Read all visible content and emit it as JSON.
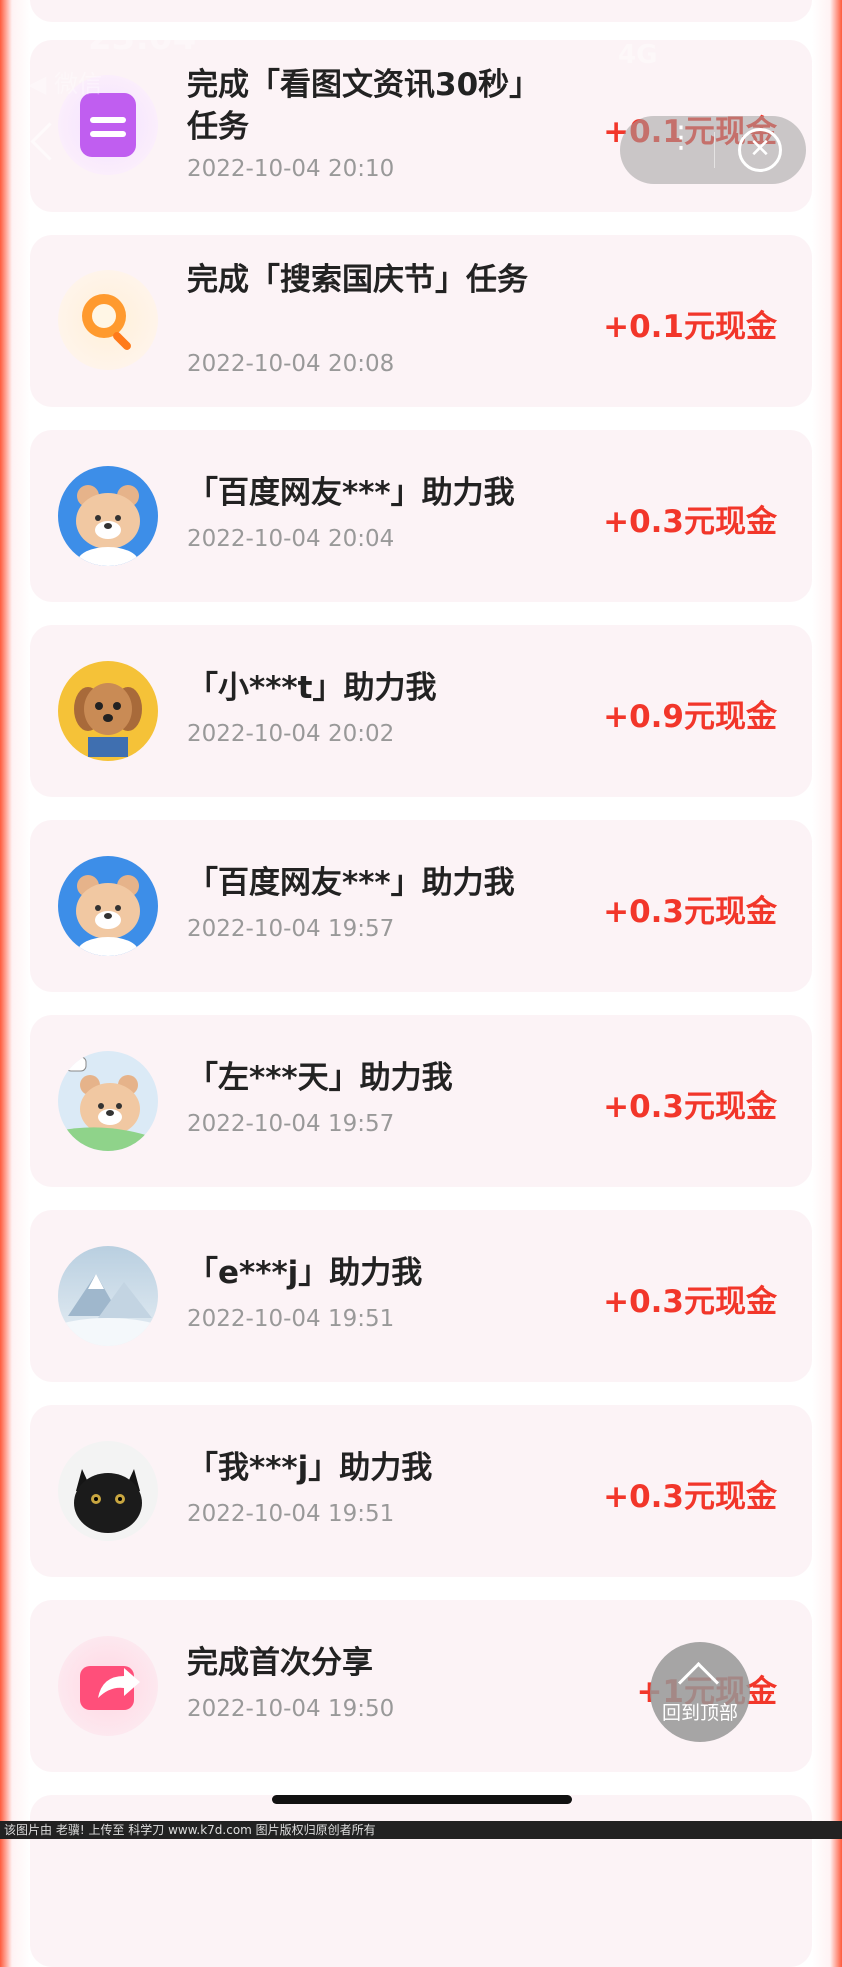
{
  "status_bar": {
    "time": "23:04",
    "back_app": "◀ 微信",
    "network": "4G"
  },
  "records": [
    {
      "title": "完成「看图文资讯30秒」任务",
      "timestamp": "2022-10-04 20:10",
      "reward": "+0.1元现金",
      "avatar": "document-task-icon"
    },
    {
      "title": "完成「搜索国庆节」任务",
      "timestamp": "2022-10-04 20:08",
      "reward": "+0.1元现金",
      "avatar": "search-task-icon"
    },
    {
      "title": "「百度网友***」助力我",
      "timestamp": "2022-10-04 20:04",
      "reward": "+0.3元现金",
      "avatar": "bear-avatar"
    },
    {
      "title": "「小***t」助力我",
      "timestamp": "2022-10-04 20:02",
      "reward": "+0.9元现金",
      "avatar": "dog-avatar"
    },
    {
      "title": "「百度网友***」助力我",
      "timestamp": "2022-10-04 19:57",
      "reward": "+0.3元现金",
      "avatar": "bear-avatar"
    },
    {
      "title": "「左***天」助力我",
      "timestamp": "2022-10-04 19:57",
      "reward": "+0.3元现金",
      "avatar": "bear-hi-avatar"
    },
    {
      "title": "「e***j」助力我",
      "timestamp": "2022-10-04 19:51",
      "reward": "+0.3元现金",
      "avatar": "mountain-avatar"
    },
    {
      "title": "「我***j」助力我",
      "timestamp": "2022-10-04 19:51",
      "reward": "+0.3元现金",
      "avatar": "cat-avatar"
    },
    {
      "title": "完成首次分享",
      "timestamp": "2022-10-04 19:50",
      "reward": "+1元现金",
      "avatar": "share-task-icon"
    }
  ],
  "back_to_top": {
    "label": "回到顶部"
  },
  "watermark": "该图片由 老骥! 上传至 科学刀 www.k7d.com 图片版权归原创者所有",
  "colors": {
    "reward": "#f2362a",
    "card_bg": "#fcf3f6",
    "edge": "#ff5a3c"
  }
}
